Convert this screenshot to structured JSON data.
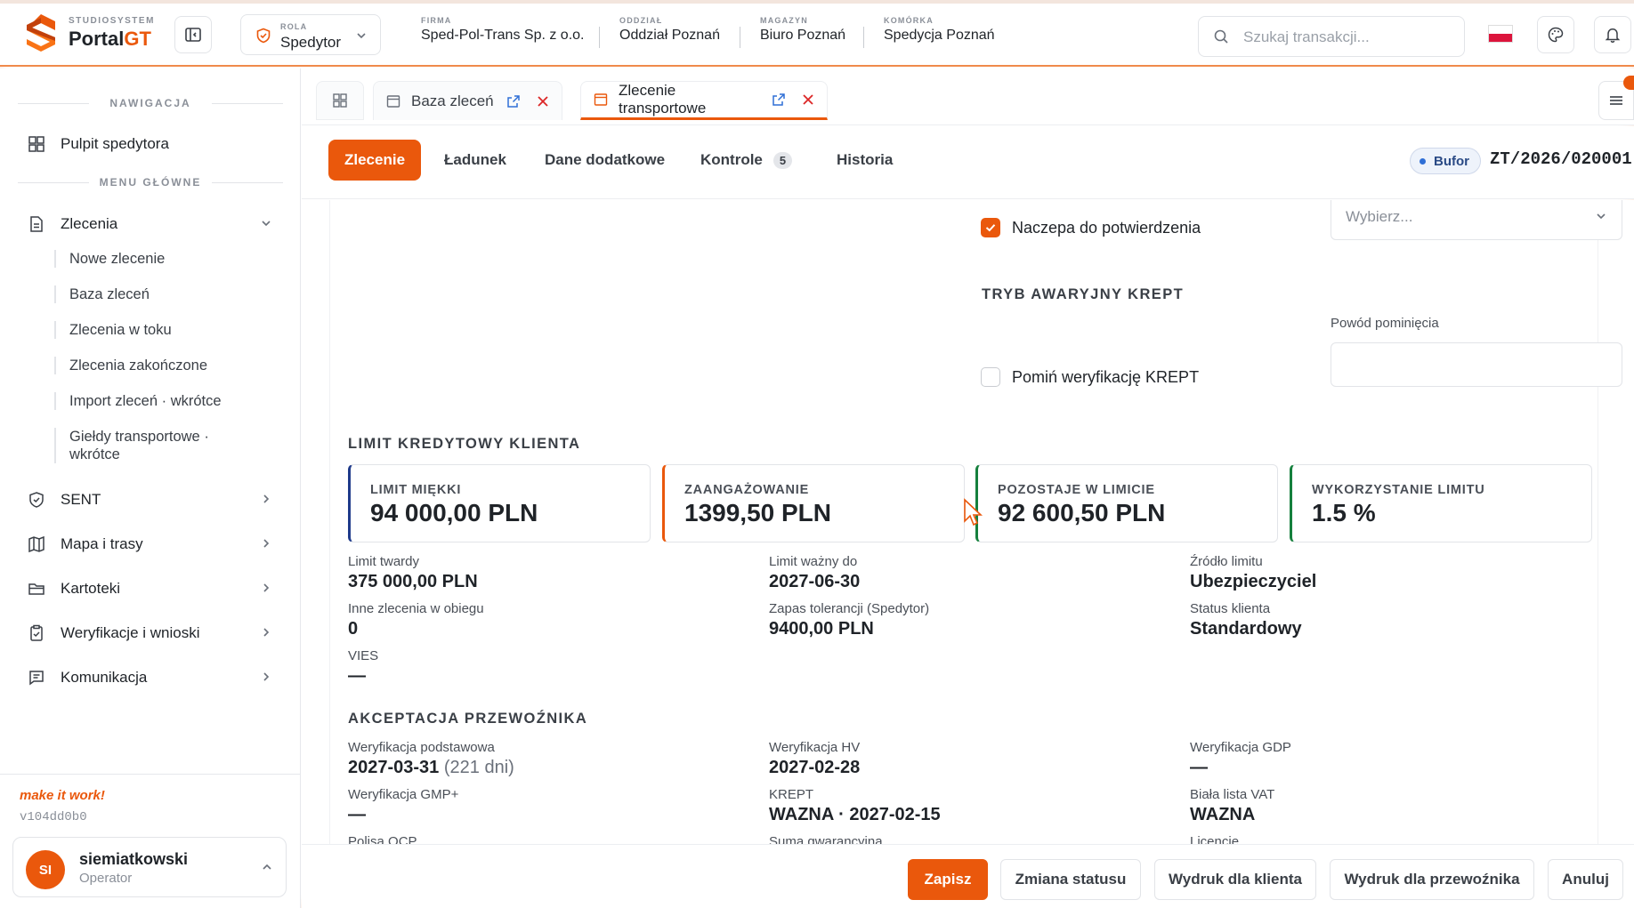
{
  "brand": {
    "sub": "STUDIOSYSTEM",
    "name_main": "Portal",
    "name_accent": "GT"
  },
  "header": {
    "role_label": "ROLA",
    "role_value": "Spedytor",
    "firma_label": "FIRMA",
    "firma_value": "Sped-Pol-Trans Sp. z o.o.",
    "oddzial_label": "ODDZIAŁ",
    "oddzial_value": "Oddział Poznań",
    "magazyn_label": "MAGAZYN",
    "magazyn_value": "Biuro Poznań",
    "komorka_label": "KOMÓRKA",
    "komorka_value": "Spedycja Poznań",
    "search_placeholder": "Szukaj transakcji..."
  },
  "sidebar": {
    "nav_section": "NAWIGACJA",
    "dashboard": "Pulpit spedytora",
    "menu_section": "MENU GŁÓWNE",
    "zlecenia": "Zlecenia",
    "sub_items": [
      "Nowe zlecenie",
      "Baza zleceń",
      "Zlecenia w toku",
      "Zlecenia zakończone",
      "Import zleceń · wkrótce",
      "Giełdy transportowe · wkrótce"
    ],
    "items": [
      "SENT",
      "Mapa i trasy",
      "Kartoteki",
      "Weryfikacje i wnioski",
      "Komunikacja"
    ],
    "tagline": "make it work!",
    "version": "v104dd0b0",
    "user": {
      "initials": "SI",
      "name": "siemiatkowski",
      "role": "Operator"
    }
  },
  "tabs": [
    {
      "label": "Baza zleceń"
    },
    {
      "label": "Zlecenie transportowe"
    }
  ],
  "subtabs": {
    "zlecenie": "Zlecenie",
    "ladunek": "Ładunek",
    "dane": "Dane dodatkowe",
    "kontrole": "Kontrole",
    "kontrole_count": "5",
    "historia": "Historia"
  },
  "status": {
    "bufor": "Bufor",
    "order_no": "ZT/2026/020001"
  },
  "form": {
    "naczepa_label": "Naczepa do potwierdzenia",
    "select_placeholder": "Wybierz...",
    "krept_section": "TRYB AWARYJNY KREPT",
    "powod_label": "Powód pominięcia",
    "pomin_label": "Pomiń weryfikację KREPT"
  },
  "credit": {
    "section": "LIMIT KREDYTOWY KLIENTA",
    "kpis": [
      {
        "label": "LIMIT MIĘKKI",
        "value": "94 000,00 PLN",
        "color": "#1e3a8a"
      },
      {
        "label": "ZAANGAŻOWANIE",
        "value": "1399,50 PLN",
        "color": "#ea580c"
      },
      {
        "label": "POZOSTAJE W LIMICIE",
        "value": "92 600,50 PLN",
        "color": "#15803d"
      },
      {
        "label": "WYKORZYSTANIE LIMITU",
        "value": "1.5 %",
        "color": "#15803d"
      }
    ],
    "limit_twardy_label": "Limit twardy",
    "limit_twardy_value": "375 000,00 PLN",
    "limit_wazny_label": "Limit ważny do",
    "limit_wazny_value": "2027-06-30",
    "zrodlo_label": "Źródło limitu",
    "zrodlo_value": "Ubezpieczyciel",
    "inne_label": "Inne zlecenia w obiegu",
    "inne_value": "0",
    "zapas_label": "Zapas tolerancji (Spedytor)",
    "zapas_value": "9400,00 PLN",
    "status_klienta_label": "Status klienta",
    "status_klienta_value": "Standardowy",
    "vies_label": "VIES",
    "vies_value": "—"
  },
  "carrier": {
    "section": "AKCEPTACJA PRZEWOŹNIKA",
    "podst_label": "Weryfikacja podstawowa",
    "podst_value": "2027-03-31",
    "podst_days": "(221 dni)",
    "hv_label": "Weryfikacja HV",
    "hv_value": "2027-02-28",
    "gdp_label": "Weryfikacja GDP",
    "gdp_value": "—",
    "gmp_label": "Weryfikacja GMP+",
    "gmp_value": "—",
    "krept_label": "KREPT",
    "krept_value": "WAZNA · 2027-02-15",
    "vat_label": "Biała lista VAT",
    "vat_value": "WAZNA",
    "ocp_label": "Polisa OCP",
    "suma_label": "Suma gwarancyjna",
    "licencje_label": "Licencje"
  },
  "footer": {
    "save": "Zapisz",
    "status": "Zmiana statusu",
    "print_client": "Wydruk dla klienta",
    "print_carrier": "Wydruk dla przewoźnika",
    "cancel": "Anuluj"
  },
  "colors": {
    "accent": "#ea580c",
    "text": "#1f2328",
    "muted": "#8a8f98"
  }
}
